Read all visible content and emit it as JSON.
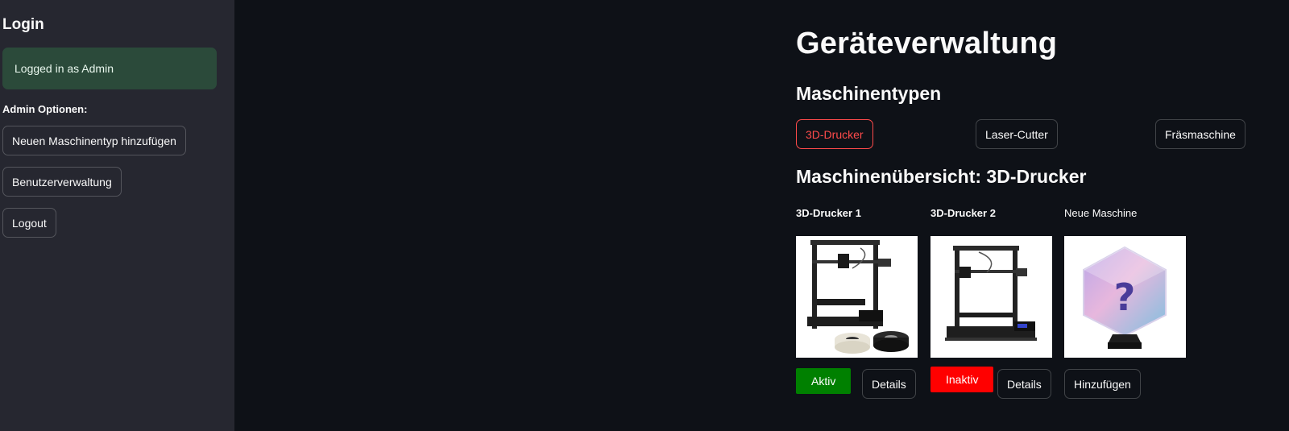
{
  "sidebar": {
    "title": "Login",
    "status_message": "Logged in as Admin",
    "admin_label": "Admin Optionen:",
    "buttons": [
      "Neuen Maschinentyp hinzufügen",
      "Benutzerverwaltung",
      "Logout"
    ]
  },
  "main": {
    "title": "Geräteverwaltung",
    "types_heading": "Maschinentypen",
    "types": [
      "3D-Drucker",
      "Laser-Cutter",
      "Fräsmaschine"
    ],
    "selected_type": "3D-Drucker",
    "overview_heading": "Maschinenübersicht: 3D-Drucker",
    "machines": [
      {
        "name": "3D-Drucker 1",
        "status": "Aktiv",
        "status_color": "#008000",
        "action": "Details",
        "image": "3d-printer-with-filament-image"
      },
      {
        "name": "3D-Drucker 2",
        "status": "Inaktiv",
        "status_color": "#ff0000",
        "action": "Details",
        "image": "3d-printer-image"
      },
      {
        "name": "Neue Maschine",
        "action": "Hinzufügen",
        "image": "question-block-lamp-image"
      }
    ]
  },
  "colors": {
    "background": "#0e1117",
    "sidebar": "#262730",
    "success_box": "#2b4a3a",
    "accent": "#ff4b4b"
  }
}
